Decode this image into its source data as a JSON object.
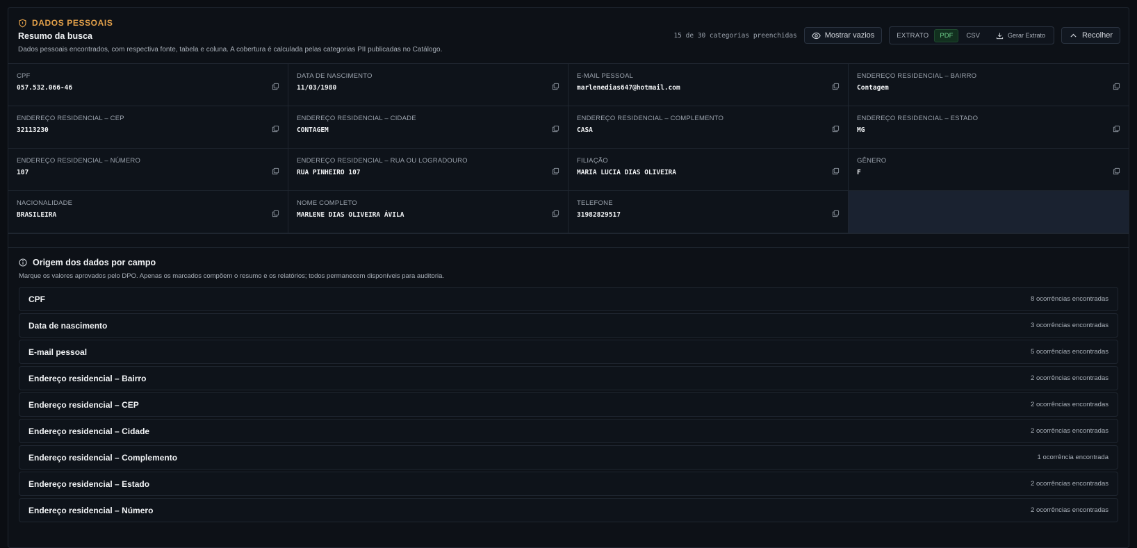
{
  "header": {
    "section_tag": "DADOS PESSOAIS",
    "title": "Resumo da busca",
    "description": "Dados pessoais encontrados, com respectiva fonte, tabela e coluna. A cobertura é calculada pelas categorias PII publicadas no Catálogo.",
    "count_text": "15 de 30 categorias preenchidas",
    "show_empty_label": "Mostrar vazios",
    "extract_label": "EXTRATO",
    "format_pdf": "PDF",
    "format_csv": "CSV",
    "generate_label": "Gerar Extrato",
    "collapse_label": "Recolher"
  },
  "fields": [
    {
      "label": "CPF",
      "value": "057.532.066-46"
    },
    {
      "label": "DATA DE NASCIMENTO",
      "value": "11/03/1980"
    },
    {
      "label": "E-MAIL PESSOAL",
      "value": "marlenedias647@hotmail.com"
    },
    {
      "label": "ENDEREÇO RESIDENCIAL – BAIRRO",
      "value": "Contagem"
    },
    {
      "label": "ENDEREÇO RESIDENCIAL – CEP",
      "value": "32113230"
    },
    {
      "label": "ENDEREÇO RESIDENCIAL – CIDADE",
      "value": "CONTAGEM"
    },
    {
      "label": "ENDEREÇO RESIDENCIAL – COMPLEMENTO",
      "value": "CASA"
    },
    {
      "label": "ENDEREÇO RESIDENCIAL – ESTADO",
      "value": "MG"
    },
    {
      "label": "ENDEREÇO RESIDENCIAL – NÚMERO",
      "value": "107"
    },
    {
      "label": "ENDEREÇO RESIDENCIAL – RUA OU LOGRADOURO",
      "value": "RUA PINHEIRO 107"
    },
    {
      "label": "FILIAÇÃO",
      "value": "MARIA LUCIA DIAS OLIVEIRA"
    },
    {
      "label": "GÊNERO",
      "value": "F"
    },
    {
      "label": "NACIONALIDADE",
      "value": "BRASILEIRA"
    },
    {
      "label": "NOME COMPLETO",
      "value": "MARLENE DIAS OLIVEIRA ÁVILA"
    },
    {
      "label": "TELEFONE",
      "value": "31982829517"
    }
  ],
  "origin": {
    "title": "Origem dos dados por campo",
    "description": "Marque os valores aprovados pelo DPO. Apenas os marcados compõem o resumo e os relatórios; todos permanecem disponíveis para auditoria.",
    "items": [
      {
        "name": "CPF",
        "count": "8 ocorrências encontradas"
      },
      {
        "name": "Data de nascimento",
        "count": "3 ocorrências encontradas"
      },
      {
        "name": "E-mail pessoal",
        "count": "5 ocorrências encontradas"
      },
      {
        "name": "Endereço residencial – Bairro",
        "count": "2 ocorrências encontradas"
      },
      {
        "name": "Endereço residencial – CEP",
        "count": "2 ocorrências encontradas"
      },
      {
        "name": "Endereço residencial – Cidade",
        "count": "2 ocorrências encontradas"
      },
      {
        "name": "Endereço residencial – Complemento",
        "count": "1 ocorrência encontrada"
      },
      {
        "name": "Endereço residencial – Estado",
        "count": "2 ocorrências encontradas"
      },
      {
        "name": "Endereço residencial – Número",
        "count": "2 ocorrências encontradas"
      }
    ]
  },
  "colors": {
    "accent": "#e3a14a",
    "pdf_active": "#6fd08c",
    "background": "#0d1117"
  },
  "icons": {
    "section": "shield-icon",
    "show_empty": "eye-icon",
    "generate": "download-icon",
    "collapse": "chevron-up-icon",
    "copy": "copy-icon",
    "origin": "info-icon"
  }
}
